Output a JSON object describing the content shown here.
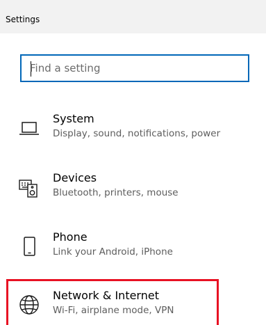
{
  "window": {
    "title": "Settings"
  },
  "search": {
    "placeholder": "Find a setting",
    "value": ""
  },
  "categories": [
    {
      "label": "System",
      "description": "Display, sound, notifications, power",
      "icon": "laptop-icon"
    },
    {
      "label": "Devices",
      "description": "Bluetooth, printers, mouse",
      "icon": "keyboard-speaker-icon"
    },
    {
      "label": "Phone",
      "description": "Link your Android, iPhone",
      "icon": "phone-icon"
    },
    {
      "label": "Network & Internet",
      "description": "Wi-Fi, airplane mode, VPN",
      "icon": "globe-icon"
    }
  ],
  "colors": {
    "accent": "#0067b8",
    "highlight": "#e81123",
    "titlebar": "#f2f2f2",
    "secondary_text": "#5d5d5d"
  }
}
